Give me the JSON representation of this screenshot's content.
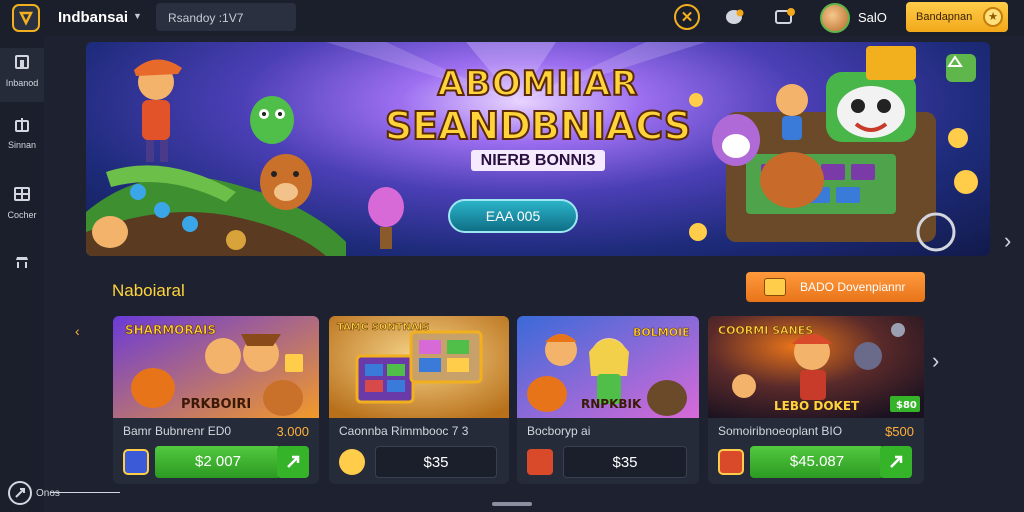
{
  "app": {
    "name": "Indbansai",
    "search_value": "Rsandoy :1V7",
    "balance": "SalO",
    "deposit_label": "Bandapnan"
  },
  "sidebar": {
    "items": [
      {
        "label": "Inbanod",
        "icon": "home-icon"
      },
      {
        "label": "Sinnan",
        "icon": "gift-icon"
      },
      {
        "label": "Cocher",
        "icon": "grid-icon"
      },
      {
        "label": "",
        "icon": "trophy-icon"
      }
    ],
    "bottom_label": "Onos"
  },
  "hero": {
    "title_line1": "ABOMIIAR",
    "title_line2": "SEANDBNIACS",
    "subtitle": "NIERB BONNI3",
    "button_label": "EAA 005"
  },
  "section": {
    "title": "Naboiaral",
    "button_label": "BADO Dovenpiannr"
  },
  "cards": [
    {
      "art_title": "SHARMORAIS",
      "art_label": "PRKBOIRI",
      "title": "Bamr Bubnrenr ED0",
      "price": "3.000",
      "cta": "$2 007"
    },
    {
      "art_title": "TAMC SONTNAIS",
      "art_label": "",
      "title": "Caonnba Rimmbooc 7 3",
      "price": "",
      "cta": "$35"
    },
    {
      "art_title": "BOLMOIE",
      "art_label": "RNPKBIK",
      "title": "Bocboryp ai",
      "price": "",
      "cta": "$35"
    },
    {
      "art_title": "COORMI SANES",
      "art_label": "LEBO DOKET",
      "badge": "$80",
      "title": "Somoiribnoeoplant BIO",
      "price": "$500",
      "cta": "$45.087"
    }
  ],
  "colors": {
    "accent": "#ffd43b",
    "green": "#35b42a",
    "orange": "#f2a81a",
    "bg": "#1e2230"
  }
}
